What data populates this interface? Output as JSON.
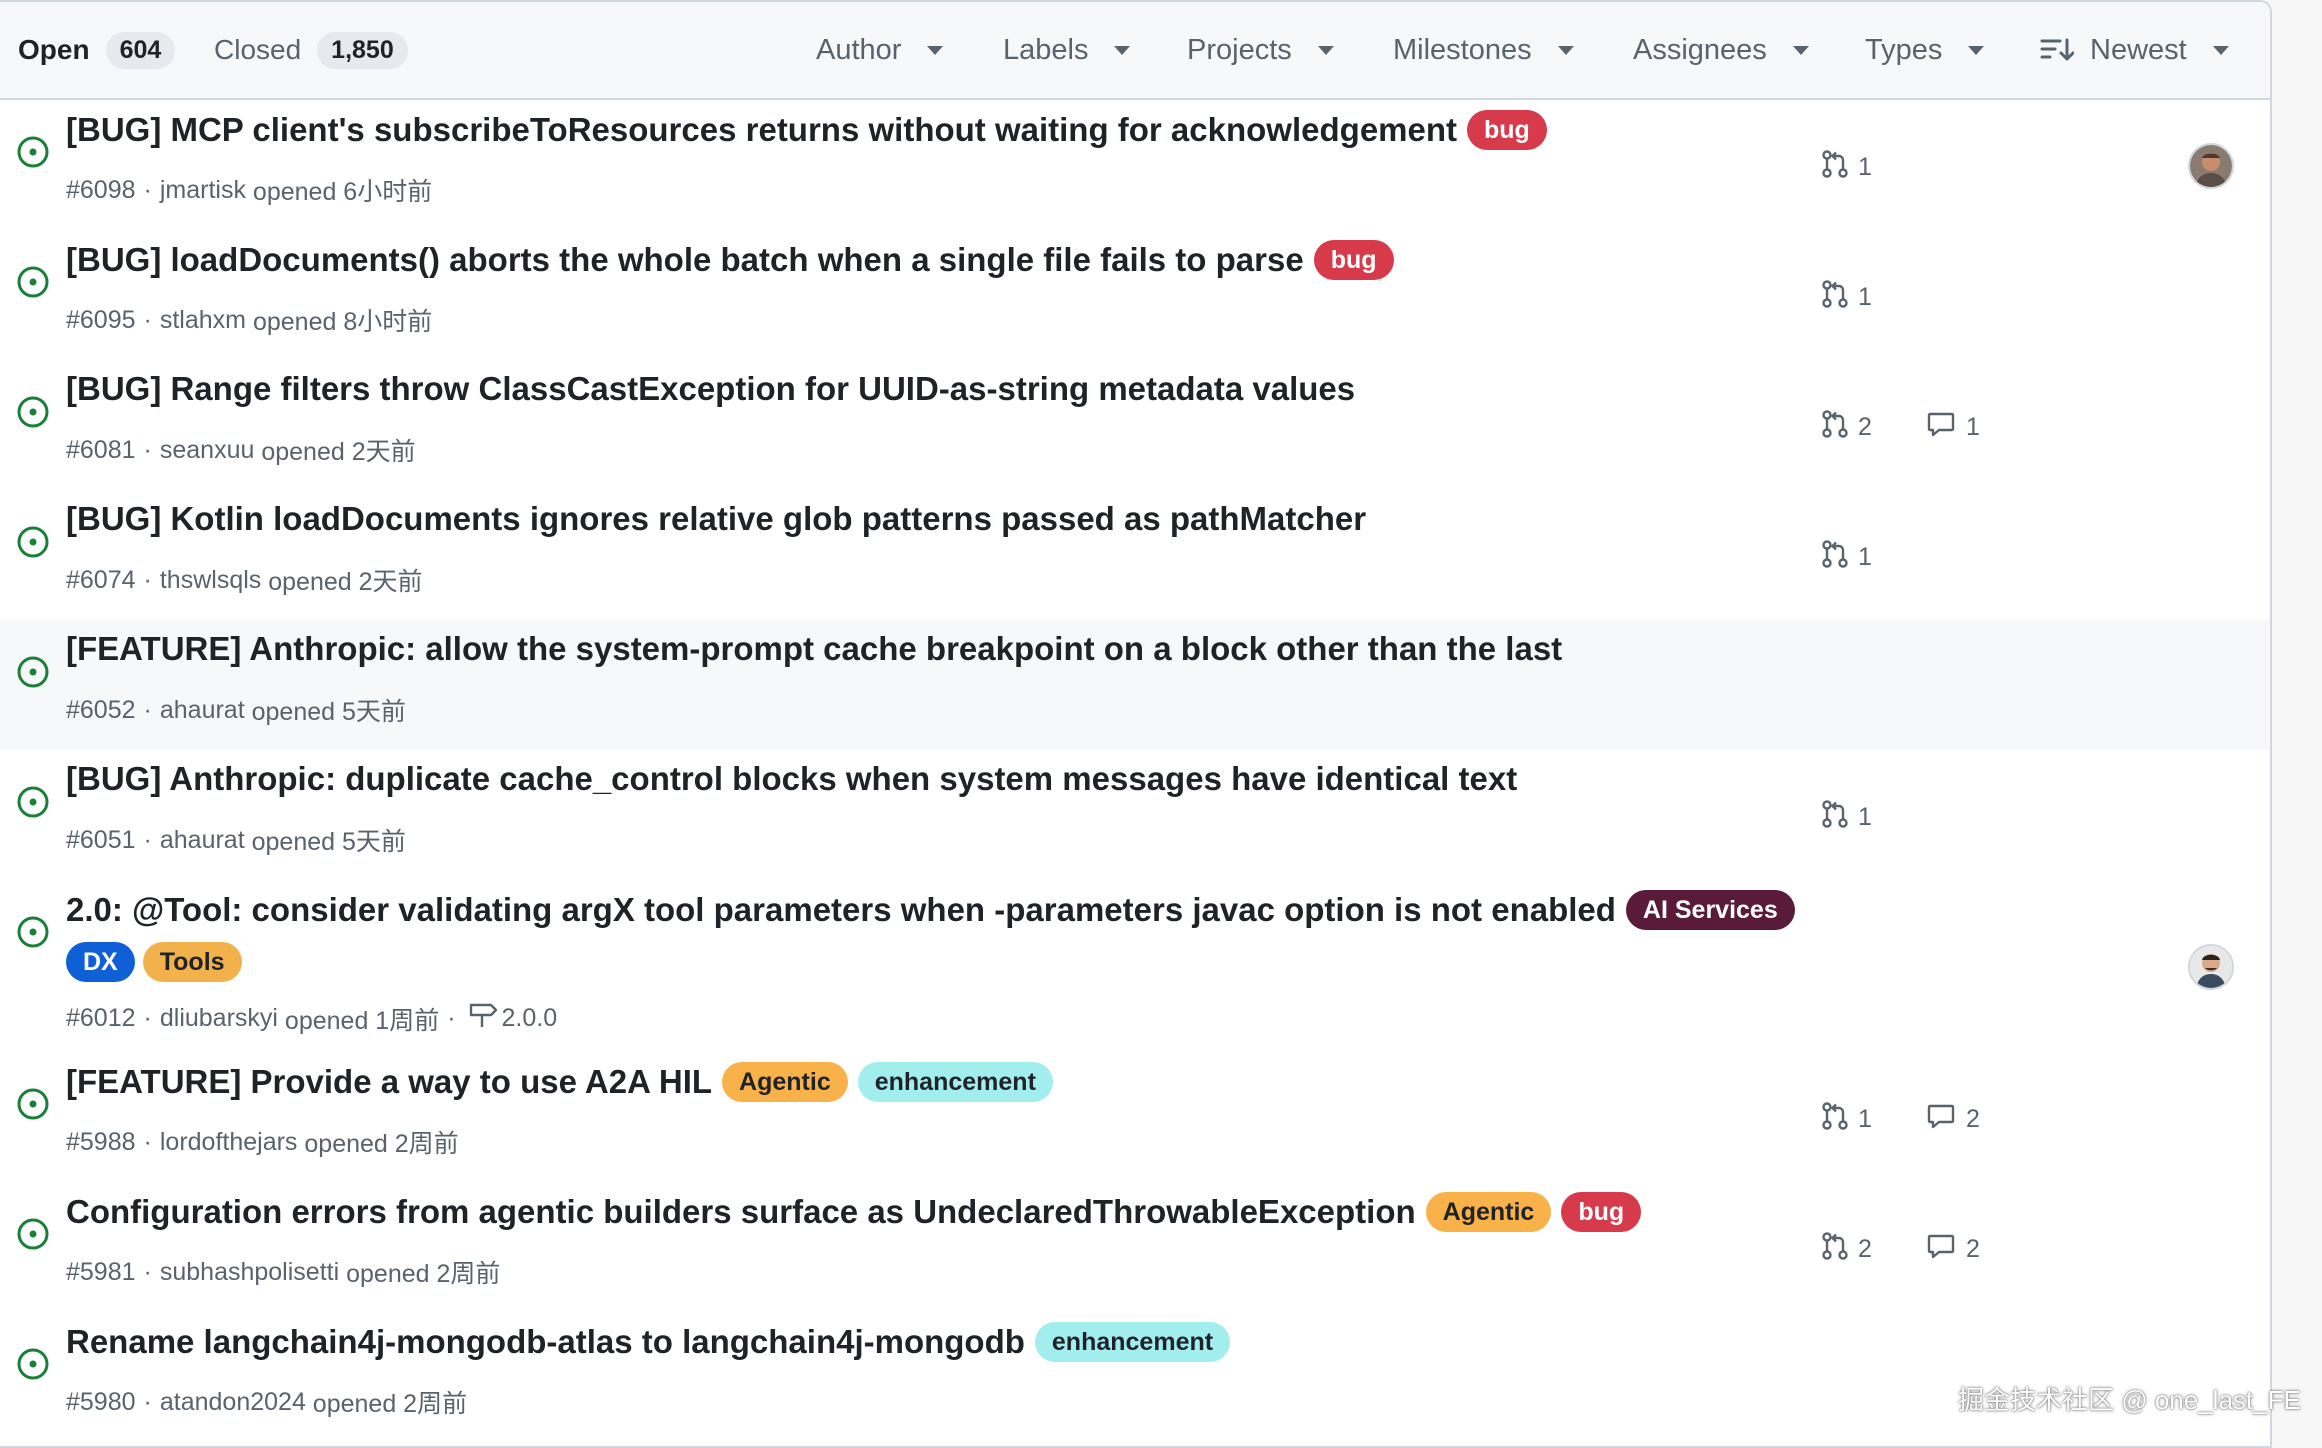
{
  "tabs": {
    "open_label": "Open",
    "open_count": "604",
    "closed_label": "Closed",
    "closed_count": "1,850"
  },
  "filters": {
    "author": "Author",
    "labels": "Labels",
    "projects": "Projects",
    "milestones": "Milestones",
    "assignees": "Assignees",
    "types": "Types",
    "sort": "Newest"
  },
  "colors": {
    "open_icon": "#1a7f37",
    "bug": "#d73a4a",
    "ai_services": "#5a1b3a",
    "dx": "#0f5fd7",
    "tools": "#f3b14c",
    "agentic": "#f9b24a",
    "enhancement": "#a2eeef"
  },
  "issues": [
    {
      "title": "[BUG] MCP client's subscribeToResources returns without waiting for acknowledgement",
      "labels": [
        {
          "name": "bug"
        }
      ],
      "number": "#6098",
      "author": "jmartisk",
      "opened": "opened 6小时前",
      "prs": "1",
      "comments": null,
      "assignee": true
    },
    {
      "title": "[BUG] loadDocuments() aborts the whole batch when a single file fails to parse",
      "labels": [
        {
          "name": "bug"
        }
      ],
      "number": "#6095",
      "author": "stlahxm",
      "opened": "opened 8小时前",
      "prs": "1",
      "comments": null,
      "assignee": false
    },
    {
      "title": "[BUG] Range filters throw ClassCastException for UUID-as-string metadata values",
      "labels": [],
      "number": "#6081",
      "author": "seanxuu",
      "opened": "opened 2天前",
      "prs": "2",
      "comments": "1",
      "assignee": false
    },
    {
      "title": "[BUG] Kotlin loadDocuments ignores relative glob patterns passed as pathMatcher",
      "labels": [],
      "number": "#6074",
      "author": "thswlsqls",
      "opened": "opened 2天前",
      "prs": "1",
      "comments": null,
      "assignee": false
    },
    {
      "title": "[FEATURE] Anthropic: allow the system-prompt cache breakpoint on a block other than the last",
      "labels": [],
      "number": "#6052",
      "author": "ahaurat",
      "opened": "opened 5天前",
      "prs": null,
      "comments": null,
      "assignee": false
    },
    {
      "title": "[BUG] Anthropic: duplicate cache_control blocks when system messages have identical text",
      "labels": [],
      "number": "#6051",
      "author": "ahaurat",
      "opened": "opened 5天前",
      "prs": "1",
      "comments": null,
      "assignee": false
    },
    {
      "title": "2.0: @Tool: consider validating argX tool parameters when -parameters javac option is not enabled",
      "labels": [
        {
          "name": "AI Services"
        }
      ],
      "extra_labels": [
        {
          "name": "DX"
        },
        {
          "name": "Tools"
        }
      ],
      "number": "#6012",
      "author": "dliubarskyi",
      "opened": "opened 1周前",
      "milestone": "2.0.0",
      "prs": null,
      "comments": null,
      "assignee": true
    },
    {
      "title": "[FEATURE] Provide a way to use A2A HIL",
      "labels": [
        {
          "name": "Agentic"
        },
        {
          "name": "enhancement"
        }
      ],
      "number": "#5988",
      "author": "lordofthejars",
      "opened": "opened 2周前",
      "prs": "1",
      "comments": "2",
      "assignee": false
    },
    {
      "title": "Configuration errors from agentic builders surface as UndeclaredThrowableException",
      "labels": [
        {
          "name": "Agentic"
        },
        {
          "name": "bug"
        }
      ],
      "number": "#5981",
      "author": "subhashpolisetti",
      "opened": "opened 2周前",
      "prs": "2",
      "comments": "2",
      "assignee": false
    },
    {
      "title": "Rename langchain4j-mongodb-atlas to langchain4j-mongodb",
      "labels": [
        {
          "name": "enhancement"
        }
      ],
      "number": "#5980",
      "author": "atandon2024",
      "opened": "opened 2周前",
      "prs": null,
      "comments": null,
      "assignee": false
    }
  ],
  "watermark": "掘金技术社区 @ one_last_FE"
}
